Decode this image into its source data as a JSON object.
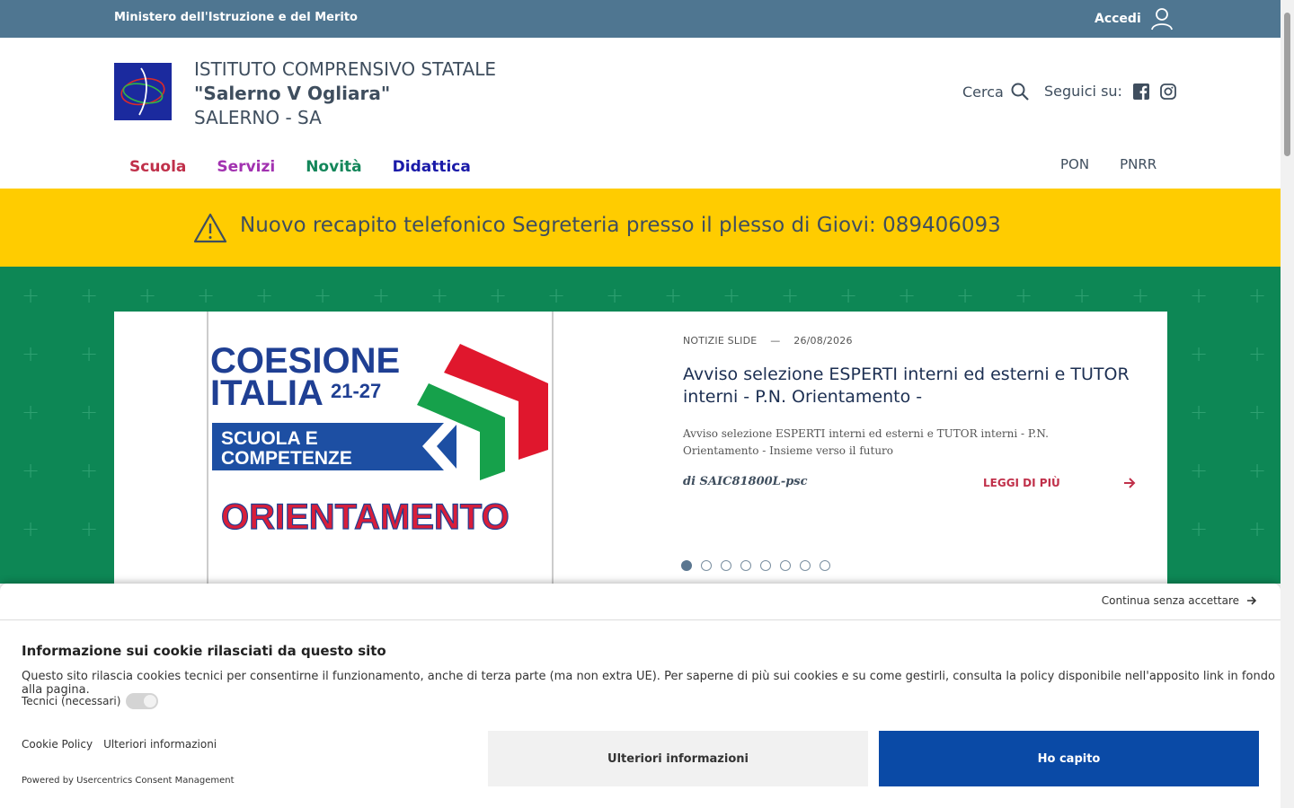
{
  "topbar": {
    "ministry": "Ministero dell'Istruzione e del Merito",
    "login_label": "Accedi"
  },
  "header": {
    "school_line1": "ISTITUTO COMPRENSIVO STATALE",
    "school_name": "\"Salerno V Ogliara\"",
    "school_city": "SALERNO - SA",
    "search_label": "Cerca",
    "follow_label": "Seguici su:"
  },
  "nav": {
    "items": [
      "Scuola",
      "Servizi",
      "Novità",
      "Didattica"
    ],
    "right_items": [
      "PON",
      "PNRR"
    ]
  },
  "alert": {
    "text": "Nuovo recapito telefonico Segreteria presso il plesso di Giovi: 089406093"
  },
  "slide": {
    "category": "NOTIZIE SLIDE",
    "date": "26/08/2026",
    "title": "Avviso selezione ESPERTI interni ed esterni e TUTOR interni - P.N. Orientamento -",
    "description": "Avviso selezione ESPERTI interni ed esterni e TUTOR interni - P.N. Orientamento - Insieme verso il futuro",
    "author": "di SAIC81800L-psc",
    "readmore": "LEGGI DI PIÙ",
    "dots_total": 8,
    "active_index": 0,
    "image": {
      "line1": "COESIONE",
      "line2": "ITALIA",
      "line2_suffix": "21-27",
      "box_line1": "SCUOLA E",
      "box_line2": "COMPETENZE",
      "bottom": "ORIENTAMENTO"
    }
  },
  "cookie": {
    "continue": "Continua senza accettare",
    "heading": "Informazione sui cookie rilasciati da questo sito",
    "body": "Questo sito rilascia cookies tecnici per consentirne il funzionamento, anche di terza parte (ma non extra UE). Per saperne di più sui cookies e su come gestirli, consulta la policy disponibile nell'apposito link in fondo alla pagina.",
    "tech_label": "Tecnici (necessari)",
    "policy_link": "Cookie Policy",
    "more_link": "Ulteriori informazioni",
    "powered": "Powered by Usercentrics Consent Management",
    "btn_more": "Ulteriori informazioni",
    "btn_ok": "Ho capito"
  },
  "colors": {
    "topbar": "#4f7691",
    "alert": "#ffcc00",
    "hero": "#0d8755",
    "primary_button": "#0a4aa6"
  }
}
